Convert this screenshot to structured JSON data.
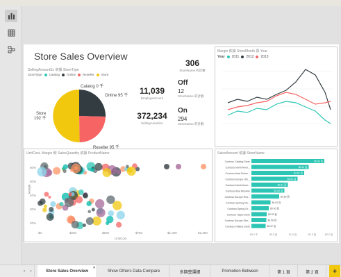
{
  "report": {
    "title": "Store Sales Overview",
    "colors": {
      "catalog": "#2dc6b4",
      "online": "#333d41",
      "reseller": "#f66463",
      "store": "#f2c80f",
      "accent": "#f2c80f"
    }
  },
  "pie": {
    "header": "SellingAmountSc 依據 StoreType",
    "legend_title": "StoreType",
    "legend": [
      "Catalog",
      "Online",
      "Reseller",
      "Store"
    ],
    "slices": [
      {
        "name": "Catalog",
        "label": "Catalog 0 千",
        "value": 0
      },
      {
        "name": "Online",
        "label": "Online 95 千",
        "value": 95
      },
      {
        "name": "Reseller",
        "label": "Reseller 95 千",
        "value": 95
      },
      {
        "name": "Store",
        "label": "Store",
        "sublabel": "192 千",
        "value": 192
      }
    ]
  },
  "kpis": [
    {
      "value": "306",
      "label": "StoreName 的計數"
    },
    {
      "value": "11,039",
      "label": "EmployeeCount"
    },
    {
      "value": "372,234",
      "label": "SellingAreaSize"
    }
  ],
  "status_cards": [
    {
      "title": "Off",
      "value": "12",
      "label": "StoreName 的計數"
    },
    {
      "title": "On",
      "value": "294",
      "label": "StoreName 的計數"
    }
  ],
  "line_chart": {
    "header": "Margin 依據 StoreMonth 與 Year",
    "legend_title": "Year",
    "series_names": [
      "2011",
      "2012",
      "2013"
    ]
  },
  "scatter": {
    "header": "UnitCost, Margin 和 SalesQuantity 依據 ProductName",
    "y_ticks": [
      "60%",
      "50%",
      "40%",
      "30%",
      "20%"
    ],
    "x_ticks": [
      "$0",
      "$250",
      "$500",
      "$750",
      "$1,000",
      "$1,250"
    ],
    "y_label": "Margin",
    "x_label": "UnitCost"
  },
  "bar_chart": {
    "header": "SalesAmount 依據 StoreName",
    "x_ticks": [
      "$0.0 千",
      "$0.5 百",
      "$1.0 百",
      "$1.5 百",
      "$2.0 百"
    ],
    "chart_data": {
      "type": "bar",
      "title": "SalesAmount 依據 StoreName",
      "categories": [
        "Contoso Catalog Store",
        "Contoso North Amer...",
        "Contoso Asia Online...",
        "Contoso Europe Onl...",
        "Contoso North Amer...",
        "Contoso Asia Reseller",
        "Contoso Europe Res...",
        "Contoso Sydney Re...",
        "Contoso Spring Gr...",
        "Contoso Taipei Store",
        "Contoso Europe Stor...",
        "Contoso Indiana Store"
      ],
      "values": [
        2.1,
        1.65,
        1.52,
        1.33,
        1.05,
        0.95,
        0.8,
        0.55,
        0.5,
        0.44,
        0.43,
        0.41
      ],
      "value_labels": [
        "$6.49 百",
        "$5.10 百",
        "$4.62 百",
        "$4.51 百",
        "$2.81 百",
        "$2.80 百",
        "$2.63 百",
        "$0.62 百",
        "$0.60 百",
        "$0.59 百",
        "$0.58 百",
        "$0.57 百"
      ]
    }
  },
  "tabs": [
    "Store Sales Overview",
    "Show Others Data Compare",
    "多期營運績",
    "Promotion Between",
    "第 1 頁",
    "第 2 頁"
  ],
  "tab_add": "+"
}
